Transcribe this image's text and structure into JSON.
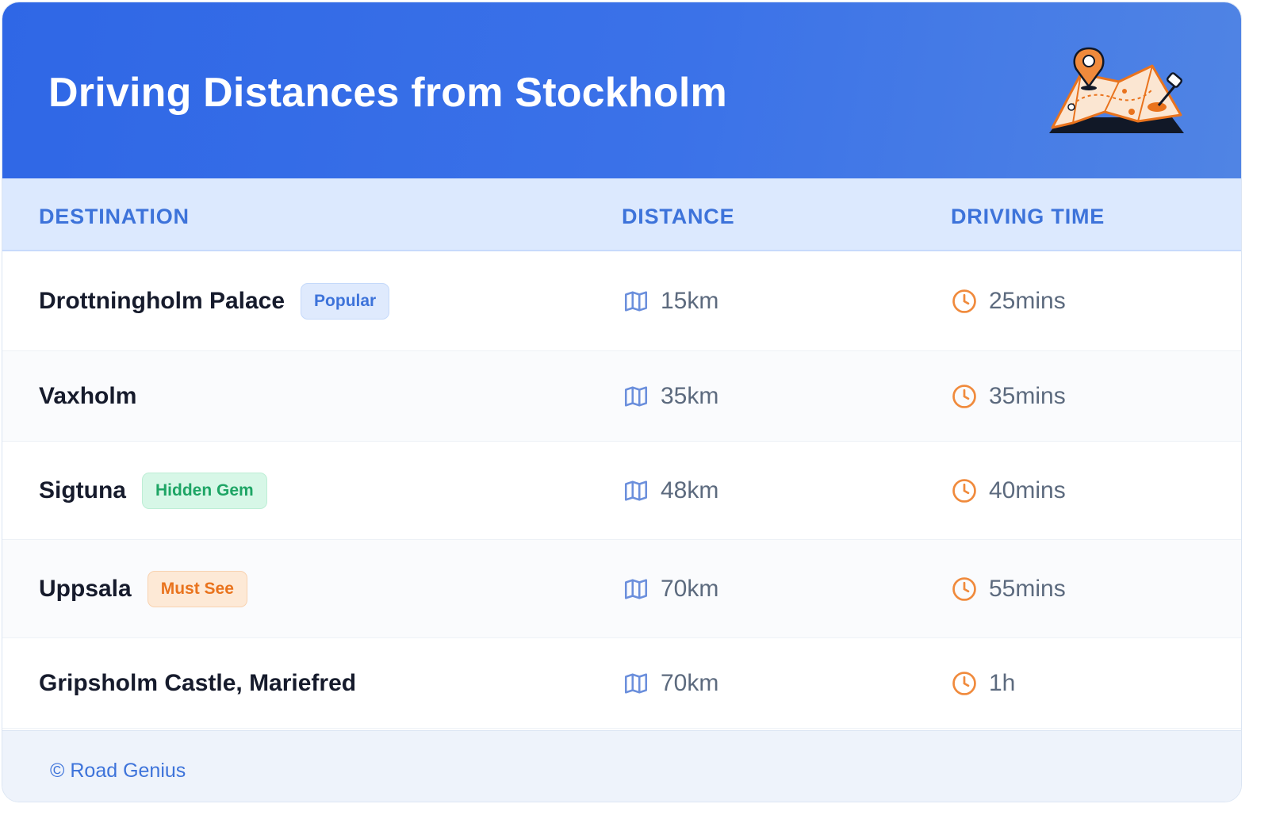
{
  "header": {
    "title": "Driving Distances from Stockholm",
    "illustration_icon": "map-with-pins-icon"
  },
  "table": {
    "columns": [
      "DESTINATION",
      "DISTANCE",
      "DRIVING TIME"
    ],
    "rows": [
      {
        "destination": "Drottningholm Palace",
        "badge": "Popular",
        "badge_color": "blue",
        "distance": "15km",
        "time": "25mins"
      },
      {
        "destination": "Vaxholm",
        "badge": "",
        "badge_color": "",
        "distance": "35km",
        "time": "35mins"
      },
      {
        "destination": "Sigtuna",
        "badge": "Hidden Gem",
        "badge_color": "green",
        "distance": "48km",
        "time": "40mins"
      },
      {
        "destination": "Uppsala",
        "badge": "Must See",
        "badge_color": "orange",
        "distance": "70km",
        "time": "55mins"
      },
      {
        "destination": "Gripsholm Castle, Mariefred",
        "badge": "",
        "badge_color": "",
        "distance": "70km",
        "time": "1h"
      }
    ],
    "distance_icon": "map-icon",
    "time_icon": "clock-icon"
  },
  "footer": {
    "copyright": "© Road Genius"
  },
  "colors": {
    "header_start": "#2f67e6",
    "header_end": "#5084e4",
    "accent_blue": "#3d73da",
    "clock_orange": "#f08a3c",
    "map_icon_blue": "#6b8fdc"
  }
}
